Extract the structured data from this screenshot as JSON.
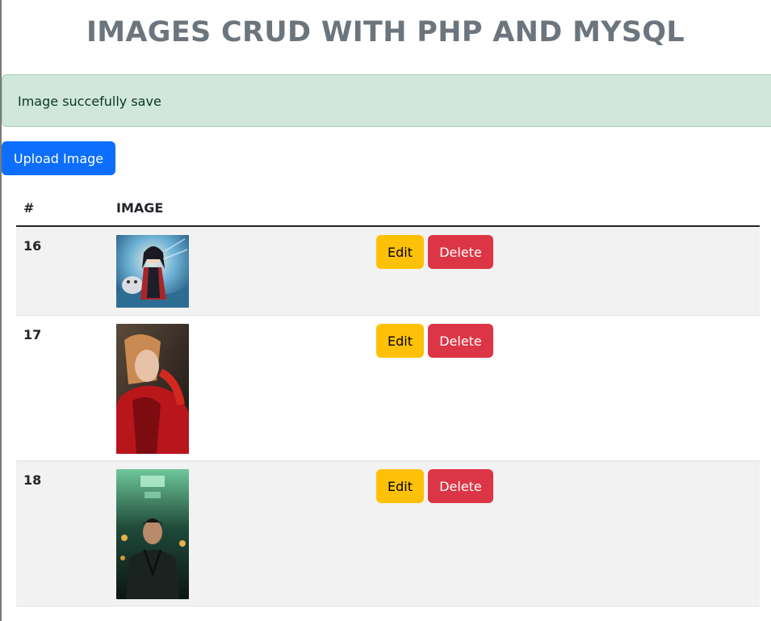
{
  "page": {
    "title": "IMAGES CRUD WITH PHP AND MYSQL"
  },
  "alert": {
    "message": "Image succefully save"
  },
  "toolbar": {
    "upload_label": "Upload Image"
  },
  "table": {
    "headers": [
      "#",
      "IMAGE"
    ],
    "rows": [
      {
        "id": "16",
        "image": "anime-girl-with-cat",
        "edit_label": "Edit",
        "delete_label": "Delete"
      },
      {
        "id": "17",
        "image": "woman-in-red-jacket",
        "edit_label": "Edit",
        "delete_label": "Delete"
      },
      {
        "id": "18",
        "image": "man-in-green-lit-corridor",
        "edit_label": "Edit",
        "delete_label": "Delete"
      }
    ]
  },
  "colors": {
    "primary": "#0d6efd",
    "warning": "#ffc107",
    "danger": "#dc3545",
    "success_bg": "#d1e7dd",
    "title": "#6c757d"
  }
}
